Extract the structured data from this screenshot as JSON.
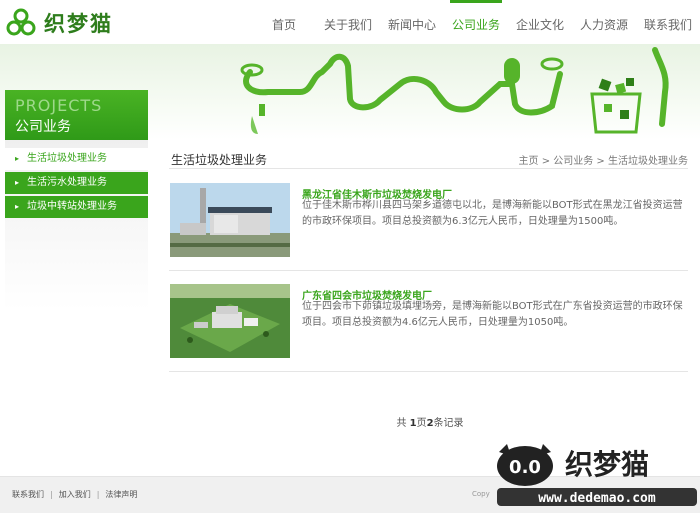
{
  "header": {
    "logo_text": "织梦猫",
    "nav": [
      "首页",
      "关于我们",
      "新闻中心",
      "公司业务",
      "企业文化",
      "人力资源",
      "联系我们"
    ],
    "active_index": 3,
    "accent": "#3aa51c"
  },
  "sidebar": {
    "title_en": "PROJECTS",
    "title_cn": "公司业务",
    "items": [
      "生活垃圾处理业务",
      "生活污水处理业务",
      "垃圾中转站处理业务"
    ]
  },
  "main": {
    "title": "生活垃圾处理业务",
    "breadcrumb": "主页 > 公司业务 > 生活垃圾处理业务",
    "items": [
      {
        "title": "黑龙江省佳木斯市垃圾焚烧发电厂",
        "desc": "位于佳木斯市桦川县四马架乡道德屯以北，是博海新能以BOT形式在黑龙江省投资运营的市政环保项目。项目总投资额为6.3亿元人民币，日处理量为1500吨。"
      },
      {
        "title": "广东省四会市垃圾焚烧发电厂",
        "desc": "位于四会市下茆镇垃圾填埋场旁，是博海新能以BOT形式在广东省投资运营的市政环保项目。项目总投资额为4.6亿元人民币，日处理量为1050吨。"
      }
    ],
    "pager": {
      "prefix": "共 ",
      "pages": "1",
      "mid": "页",
      "records": "2",
      "suffix": "条记录"
    }
  },
  "footer": {
    "links": [
      "联系我们",
      "加入我们",
      "法律声明"
    ],
    "copyright": "Copy"
  },
  "watermark": {
    "face": "0.0",
    "title": "织梦猫",
    "url": "www.dedemao.com"
  }
}
